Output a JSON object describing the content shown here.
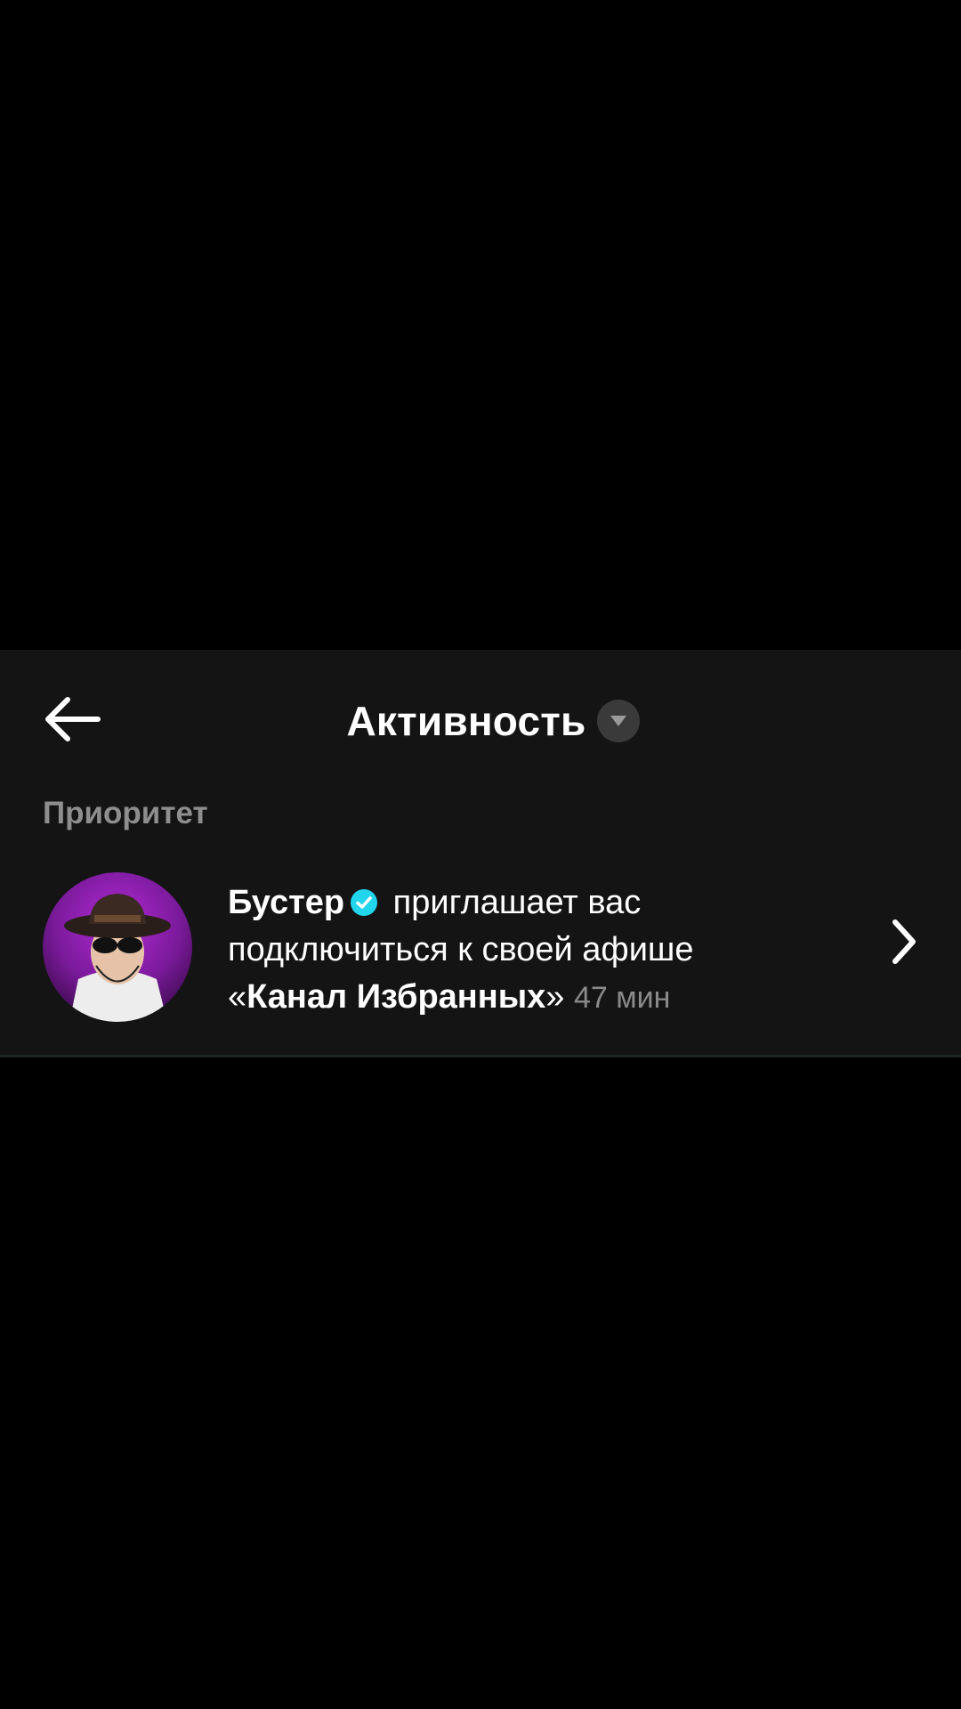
{
  "header": {
    "title": "Активность",
    "back_icon": "arrow-left-icon",
    "dropdown_icon": "caret-down-icon"
  },
  "section": {
    "label": "Приоритет"
  },
  "notification": {
    "username": "Бустер",
    "verified_icon": "verified-badge-icon",
    "text_part1": " приглашает вас подключиться к своей афише ",
    "quote_open": "«",
    "channel_name": "Канал Избранных",
    "quote_close": "»",
    "time": "47 мин",
    "chevron_icon": "chevron-right-icon"
  },
  "colors": {
    "background": "#000000",
    "panel": "#141414",
    "secondary_text": "#8e8e8e",
    "verified": "#20d5ec",
    "dropdown_bg": "#3a3a3a"
  }
}
